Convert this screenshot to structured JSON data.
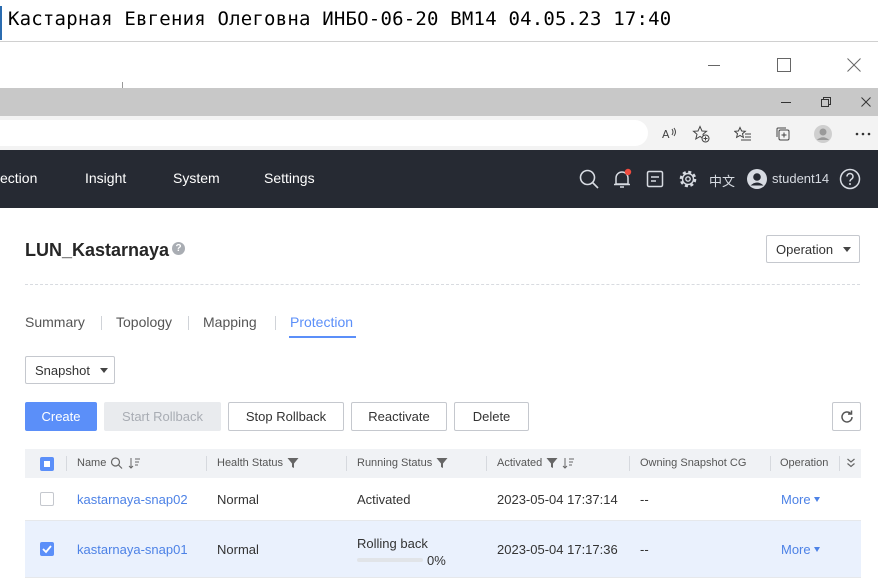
{
  "note": {
    "text": "Кастарная Евгения Олеговна ИНБО-06-20 ВМ14 04.05.23 17:40"
  },
  "app_header": {
    "nav": [
      "ection",
      "Insight",
      "System",
      "Settings"
    ],
    "language": "中文",
    "user": "student14"
  },
  "page": {
    "title": "LUN_Kastarnaya",
    "operation_label": "Operation"
  },
  "tabs": [
    "Summary",
    "Topology",
    "Mapping",
    "Protection"
  ],
  "active_tab": "Protection",
  "snapshot_select": "Snapshot",
  "toolbar": {
    "create": "Create",
    "start_rollback": "Start Rollback",
    "stop_rollback": "Stop Rollback",
    "reactivate": "Reactivate",
    "delete": "Delete"
  },
  "table": {
    "headers": {
      "name": "Name",
      "health": "Health Status",
      "running": "Running Status",
      "activated": "Activated",
      "owning": "Owning Snapshot CG",
      "operation": "Operation"
    },
    "rows": [
      {
        "checked": false,
        "name": "kastarnaya-snap02",
        "health": "Normal",
        "running": "Activated",
        "activated": "2023-05-04 17:37:14",
        "owning": "--",
        "operation": "More"
      },
      {
        "checked": true,
        "name": "kastarnaya-snap01",
        "health": "Normal",
        "running": "Rolling back",
        "progress": 0,
        "progress_label": "0%",
        "activated": "2023-05-04 17:17:36",
        "owning": "--",
        "operation": "More"
      }
    ]
  },
  "colors": {
    "header_bg": "#262a33",
    "accent": "#5b8ff9",
    "selected_row": "#eaf1fd"
  }
}
